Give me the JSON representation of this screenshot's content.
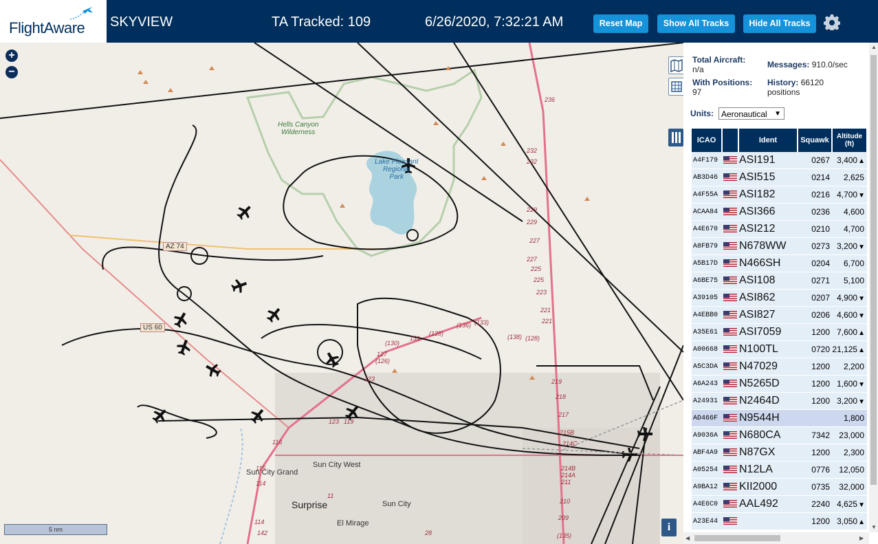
{
  "header": {
    "brand": "FlightAware",
    "app_name": "SKYVIEW",
    "tracked": "TA Tracked: 109",
    "clock": "6/26/2020, 7:32:21 AM",
    "buttons": {
      "reset": "Reset Map",
      "show": "Show All Tracks",
      "hide": "Hide All Tracks"
    },
    "accent": "#1592d9",
    "bar_color": "#002f5d"
  },
  "map": {
    "zoom_in": "+",
    "zoom_out": "−",
    "scale": "5 nm",
    "info": "i",
    "labels": {
      "wilderness": "Hells Canyon\nWilderness",
      "lake": "Lake Pleasant\nRegional\nPark",
      "sun_city_grand": "Sun City Grand",
      "sun_city_west": "Sun City West",
      "sun_city": "Sun City",
      "surprise": "Surprise",
      "el_mirage": "El Mirage",
      "az74": "AZ 74",
      "us60": "US 60"
    },
    "road_numbers": [
      "236",
      "232",
      "232",
      "229",
      "229",
      "227",
      "227",
      "225",
      "225",
      "223",
      "221",
      "221",
      "219",
      "218",
      "217",
      "215B",
      "214C",
      "214B",
      "214A",
      "211",
      "210",
      "209",
      "(135)",
      "(133)",
      "(136)",
      "(138)",
      "(128)",
      "(130)",
      "131",
      "(128)",
      "127",
      "(126)",
      "123",
      "123",
      "119",
      "116",
      "115",
      "114",
      "114",
      "142",
      "11",
      "28"
    ]
  },
  "sidebar": {
    "total_aircraft_label": "Total Aircraft:",
    "total_aircraft_value": "n/a",
    "with_positions_label": "With Positions:",
    "with_positions_value": "97",
    "messages_label": "Messages:",
    "messages_value": "910.0/sec",
    "history_label": "History:",
    "history_value": "66120",
    "history_unit": "positions",
    "units_label": "Units:",
    "units_value": "Aeronautical",
    "columns": [
      "ICAO",
      "",
      "Ident",
      "Squawk",
      "Altitude\n(ft)"
    ],
    "rows": [
      {
        "icao": "A4F179",
        "ident": "ASI191",
        "squawk": "0267",
        "alt": "3,400",
        "trend": "▲"
      },
      {
        "icao": "AB3D46",
        "ident": "ASI515",
        "squawk": "0214",
        "alt": "2,625",
        "trend": ""
      },
      {
        "icao": "A4F55A",
        "ident": "ASI182",
        "squawk": "0216",
        "alt": "4,700",
        "trend": "▼"
      },
      {
        "icao": "ACAA84",
        "ident": "ASI366",
        "squawk": "0236",
        "alt": "4,600",
        "trend": ""
      },
      {
        "icao": "A4E670",
        "ident": "ASI212",
        "squawk": "0210",
        "alt": "4,700",
        "trend": ""
      },
      {
        "icao": "A8FB79",
        "ident": "N678WW",
        "squawk": "0273",
        "alt": "3,200",
        "trend": "▼"
      },
      {
        "icao": "A5B17D",
        "ident": "N466SH",
        "squawk": "0204",
        "alt": "6,700",
        "trend": ""
      },
      {
        "icao": "A6BE75",
        "ident": "ASI108",
        "squawk": "0271",
        "alt": "5,100",
        "trend": ""
      },
      {
        "icao": "A39105",
        "ident": "ASI862",
        "squawk": "0207",
        "alt": "4,900",
        "trend": "▼"
      },
      {
        "icao": "A4EBB0",
        "ident": "ASI827",
        "squawk": "0206",
        "alt": "4,600",
        "trend": "▼"
      },
      {
        "icao": "A35E61",
        "ident": "ASI7059",
        "squawk": "1200",
        "alt": "7,600",
        "trend": "▲"
      },
      {
        "icao": "A00668",
        "ident": "N100TL",
        "squawk": "0720",
        "alt": "21,125",
        "trend": "▲"
      },
      {
        "icao": "A5C3DA",
        "ident": "N47029",
        "squawk": "1200",
        "alt": "2,200",
        "trend": ""
      },
      {
        "icao": "A6A243",
        "ident": "N5265D",
        "squawk": "1200",
        "alt": "1,600",
        "trend": "▼"
      },
      {
        "icao": "A24931",
        "ident": "N2464D",
        "squawk": "1200",
        "alt": "3,200",
        "trend": "▼"
      },
      {
        "icao": "AD466F",
        "ident": "N9544H",
        "squawk": "",
        "alt": "1,800",
        "trend": "",
        "selected": true
      },
      {
        "icao": "A9036A",
        "ident": "N680CA",
        "squawk": "7342",
        "alt": "23,000",
        "trend": ""
      },
      {
        "icao": "ABF4A9",
        "ident": "N87GX",
        "squawk": "1200",
        "alt": "2,300",
        "trend": ""
      },
      {
        "icao": "A05254",
        "ident": "N12LA",
        "squawk": "0776",
        "alt": "12,050",
        "trend": ""
      },
      {
        "icao": "A9BA12",
        "ident": "KII2000",
        "squawk": "0735",
        "alt": "32,000",
        "trend": ""
      },
      {
        "icao": "A4E6C0",
        "ident": "AAL492",
        "squawk": "2240",
        "alt": "4,625",
        "trend": "▼"
      },
      {
        "icao": "A23E44",
        "ident": "",
        "squawk": "1200",
        "alt": "3,050",
        "trend": "▲"
      }
    ]
  }
}
